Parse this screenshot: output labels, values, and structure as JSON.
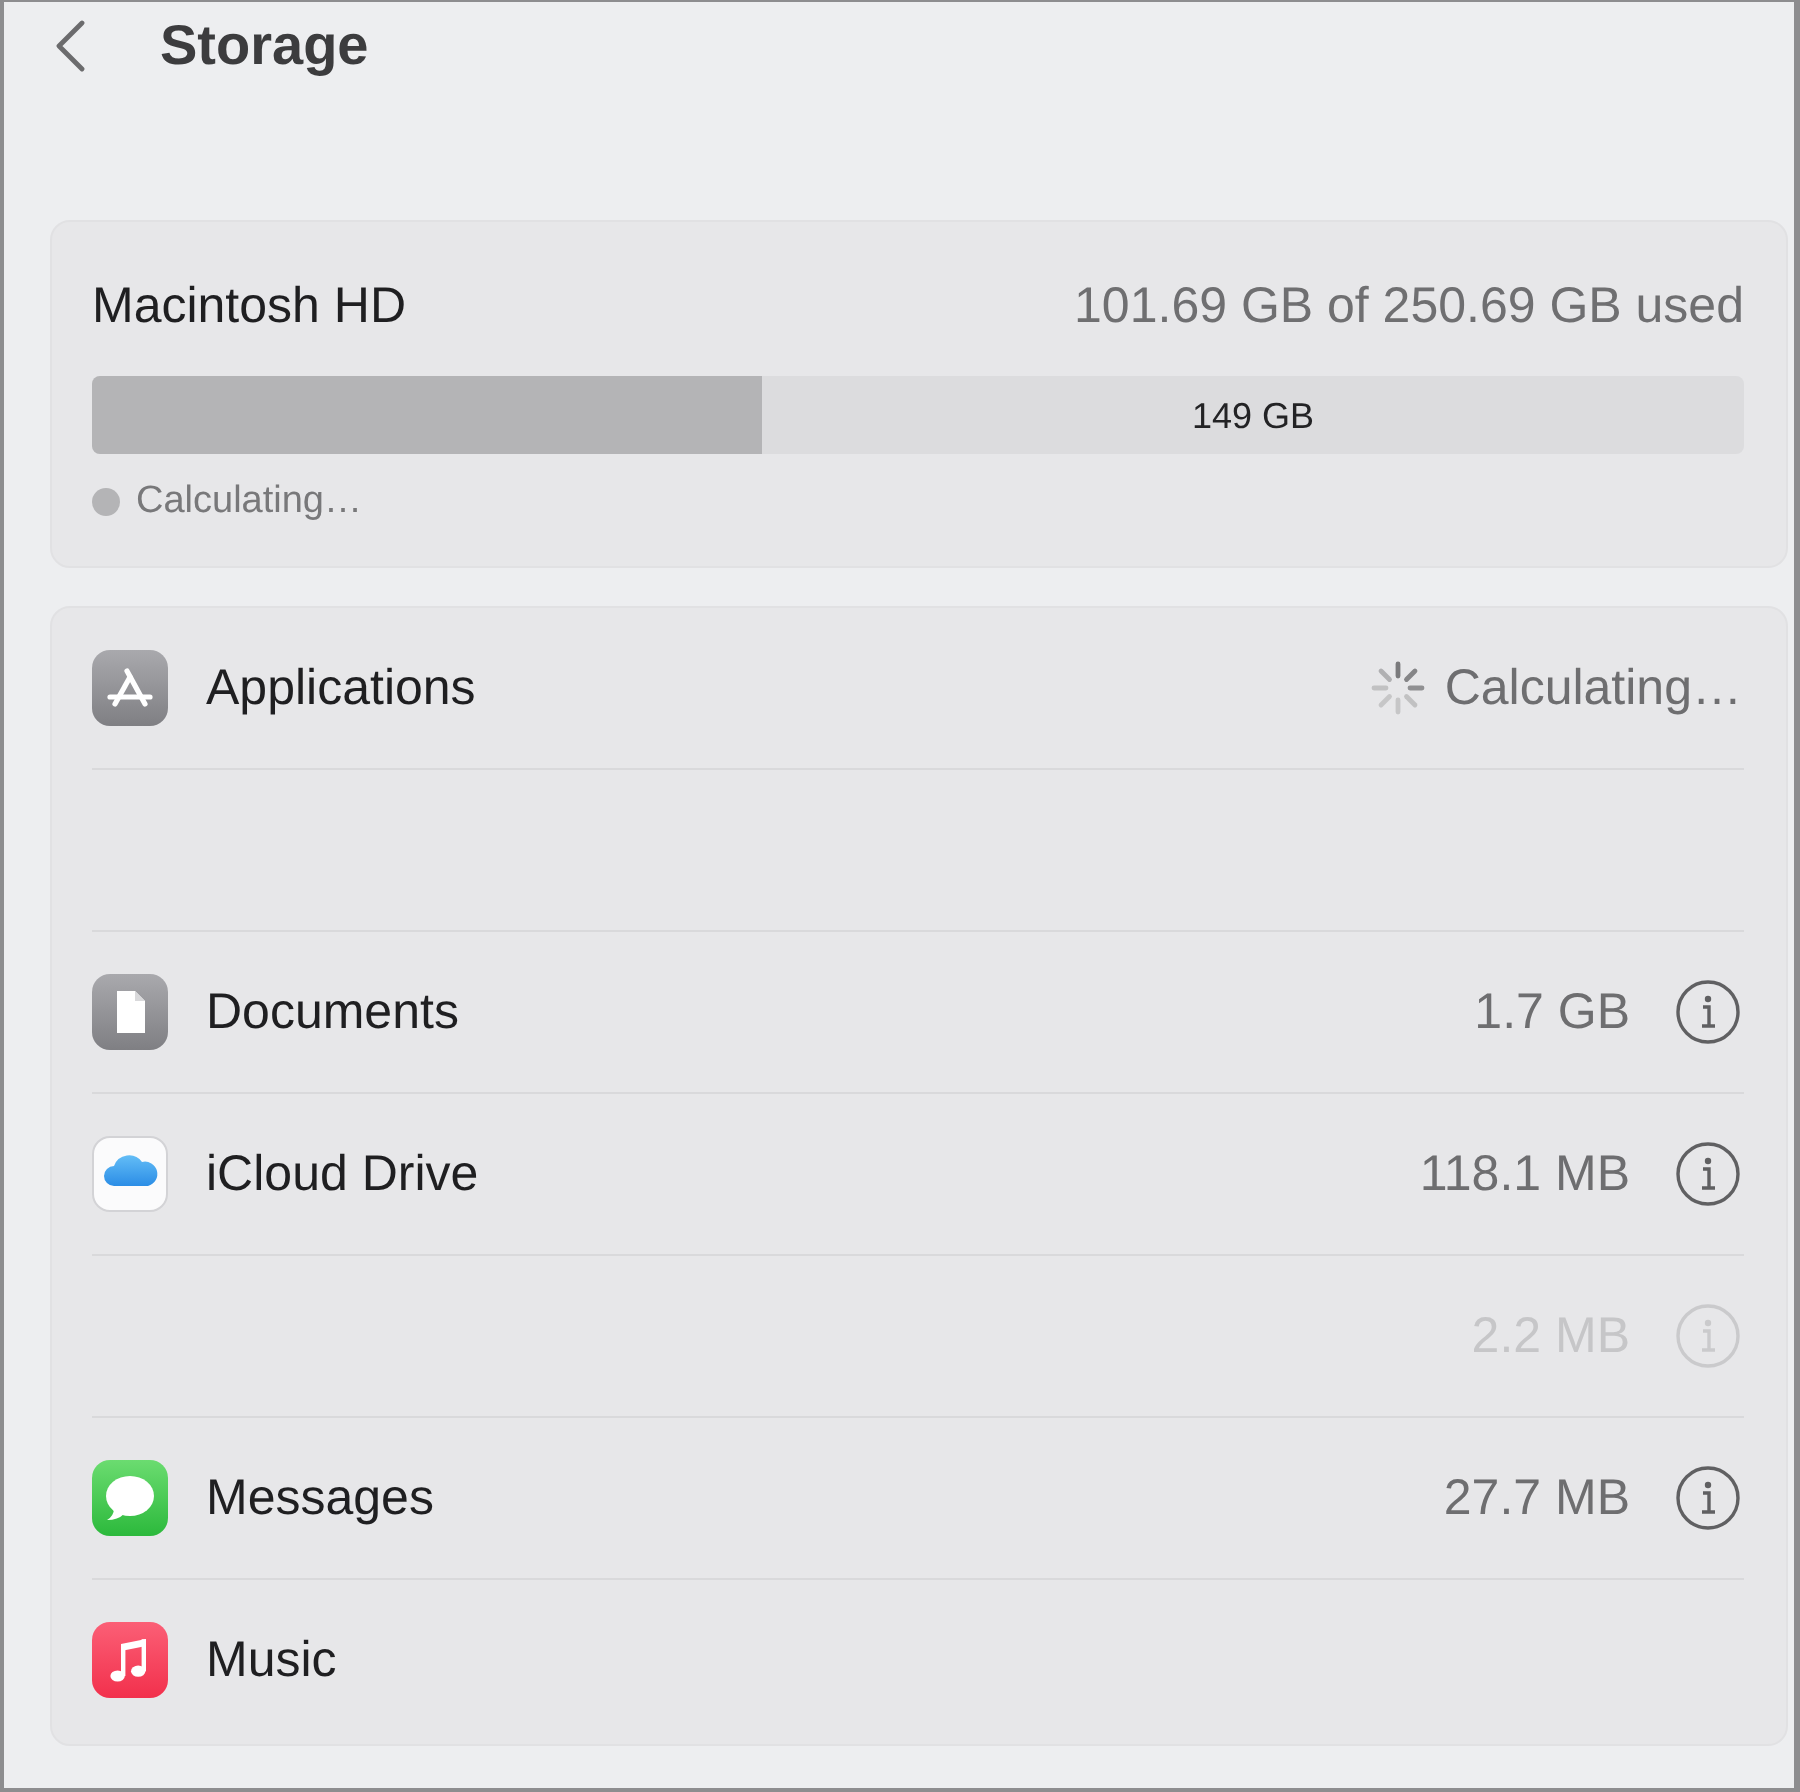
{
  "title": "Storage",
  "disk": {
    "name": "Macintosh HD",
    "usage": "101.69 GB of 250.69 GB used",
    "level": 0.4056,
    "free": "149 GB",
    "legend": [
      {
        "label": "Calculating…",
        "color": "#b4b4b6"
      }
    ]
  },
  "categories": [
    {
      "kind": "loading",
      "name": "Applications",
      "status": "Calculating…"
    },
    {
      "kind": "blank"
    },
    {
      "kind": "item",
      "name": "Documents",
      "size": "1.7 GB",
      "dimmed": false
    },
    {
      "kind": "item",
      "name": "iCloud Drive",
      "size": "118.1 MB",
      "dimmed": false
    },
    {
      "kind": "item",
      "size": "2.2 MB",
      "dimmed": true
    },
    {
      "kind": "item",
      "name": "Messages",
      "size": "27.7 MB",
      "dimmed": false
    },
    {
      "kind": "item",
      "name": "Music",
      "dimmed": false
    }
  ]
}
